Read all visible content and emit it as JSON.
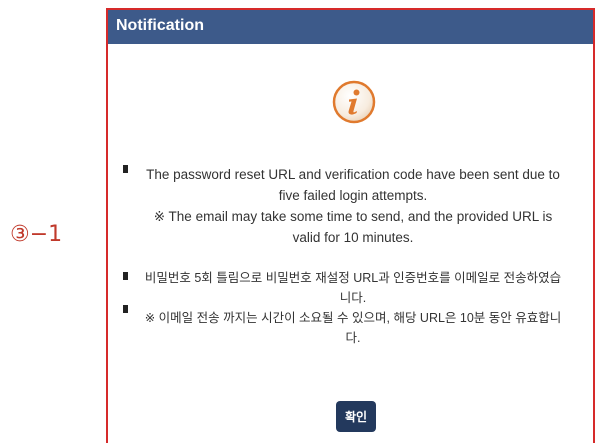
{
  "step_label": "③−1",
  "dialog": {
    "title": "Notification",
    "icon": "info-icon",
    "icon_color": "#e07a2e",
    "message_en": [
      "The password reset URL and verification code have been sent due to",
      "five failed login attempts.",
      "※ The email may take some time to send, and the provided URL is",
      "valid for 10 minutes."
    ],
    "message_ko": [
      "비밀번호 5회 틀림으로 비밀번호 재설정 URL과 인증번호를 이메일로 전송하였습",
      "니다.",
      "※ 이메일 전송 까지는 시간이 소요될 수 있으며, 해당 URL은 10분 동안 유효합니",
      "다."
    ],
    "ok_label": "확인"
  },
  "colors": {
    "titlebar": "#3d5a8a",
    "button": "#23395d",
    "border": "#d62a2a"
  }
}
